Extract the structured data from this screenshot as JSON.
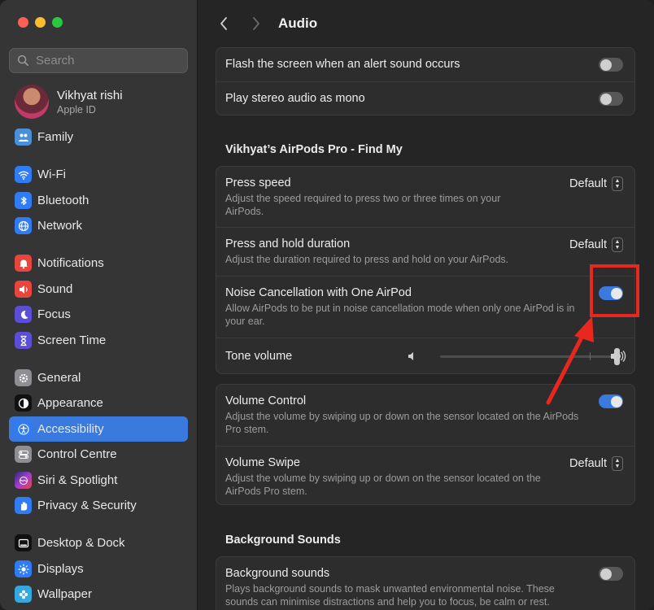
{
  "sidebar": {
    "search_placeholder": "Search",
    "profile": {
      "name": "Vikhyat rishi",
      "subtitle": "Apple ID"
    },
    "items": [
      {
        "label": "Family",
        "icon": "family-icon",
        "color": "#4a90d9"
      },
      {
        "label": "Wi-Fi",
        "icon": "wifi-icon",
        "color": "#2f7cf6"
      },
      {
        "label": "Bluetooth",
        "icon": "bluetooth-icon",
        "color": "#2f7cf6"
      },
      {
        "label": "Network",
        "icon": "globe-icon",
        "color": "#2f7cf6"
      },
      {
        "label": "Notifications",
        "icon": "bell-icon",
        "color": "#e8453c"
      },
      {
        "label": "Sound",
        "icon": "speaker-icon",
        "color": "#e8453c"
      },
      {
        "label": "Focus",
        "icon": "moon-icon",
        "color": "#5b4fd8"
      },
      {
        "label": "Screen Time",
        "icon": "hourglass-icon",
        "color": "#5b4fd8"
      },
      {
        "label": "General",
        "icon": "gear-icon",
        "color": "#8e8e93"
      },
      {
        "label": "Appearance",
        "icon": "appearance-icon",
        "color": "#111111"
      },
      {
        "label": "Accessibility",
        "icon": "accessibility-icon",
        "color": "#2f7cf6"
      },
      {
        "label": "Control Centre",
        "icon": "control-centre-icon",
        "color": "#8e8e93"
      },
      {
        "label": "Siri & Spotlight",
        "icon": "siri-icon",
        "color": "#6a3fd1"
      },
      {
        "label": "Privacy & Security",
        "icon": "hand-icon",
        "color": "#2f7cf6"
      },
      {
        "label": "Desktop & Dock",
        "icon": "dock-icon",
        "color": "#111111"
      },
      {
        "label": "Displays",
        "icon": "sun-icon",
        "color": "#2f7cf6"
      },
      {
        "label": "Wallpaper",
        "icon": "flower-icon",
        "color": "#35a8e0"
      }
    ],
    "active_index": 10
  },
  "header": {
    "title": "Audio"
  },
  "alerts": {
    "flash_label": "Flash the screen when an alert sound occurs",
    "flash_on": false,
    "mono_label": "Play stereo audio as mono",
    "mono_on": false
  },
  "airpods": {
    "section_title": "Vikhyat’s AirPods Pro - Find My",
    "press_speed": {
      "title": "Press speed",
      "desc": "Adjust the speed required to press two or three times on your AirPods.",
      "value": "Default"
    },
    "press_hold": {
      "title": "Press and hold duration",
      "desc": "Adjust the duration required to press and hold on your AirPods.",
      "value": "Default"
    },
    "noise_cancel": {
      "title": "Noise Cancellation with One AirPod",
      "desc": "Allow AirPods to be put in noise cancellation mode when only one AirPod is in your ear.",
      "on": true
    },
    "tone_volume": {
      "title": "Tone volume",
      "level": 1.0
    },
    "volume_control": {
      "title": "Volume Control",
      "desc": "Adjust the volume by swiping up or down on the sensor located on the AirPods Pro stem.",
      "on": true
    },
    "volume_swipe": {
      "title": "Volume Swipe",
      "desc": "Adjust the volume by swiping up or down on the sensor located on the AirPods Pro stem.",
      "value": "Default"
    }
  },
  "background": {
    "section_title": "Background Sounds",
    "title": "Background sounds",
    "desc": "Plays background sounds to mask unwanted environmental noise. These sounds can minimise distractions and help you to focus, be calm or rest.",
    "on": false
  },
  "colors": {
    "accent": "#3a7adf",
    "annotation": "#e8281e"
  }
}
